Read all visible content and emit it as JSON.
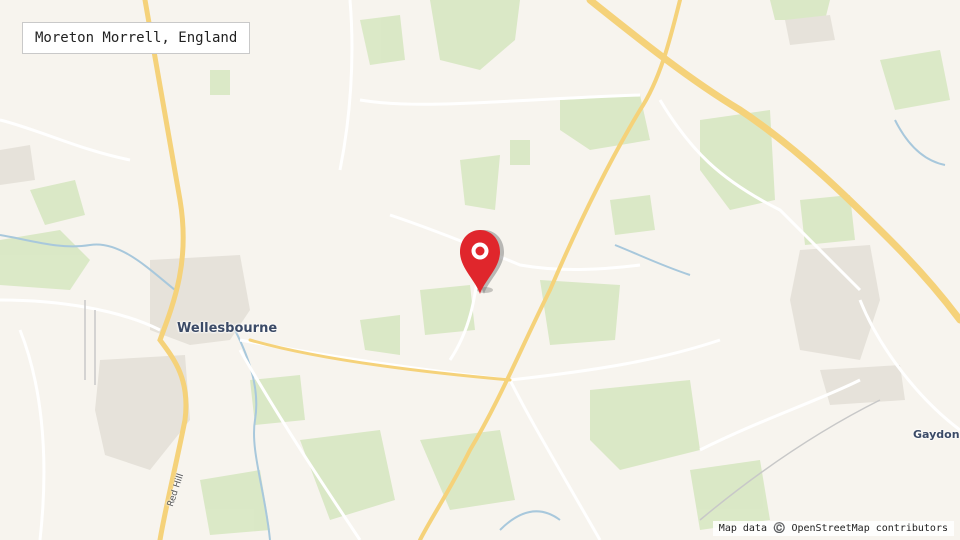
{
  "location_title": "Moreton Morrell, England",
  "places": {
    "wellesbourne": "Wellesbourne",
    "gaydon": "Gaydon"
  },
  "roads": {
    "red_hill": "Red Hill"
  },
  "attribution": "Map data ©️ OpenStreetMap contributors",
  "colors": {
    "land": "#f7f4ee",
    "woodland": "#d9e8c4",
    "water": "#a8c8dc",
    "major_road": "#f5d27a",
    "minor_road": "#ffffff",
    "urban": "#e6e2da",
    "marker": "#e0262c"
  },
  "marker_icon": "map-pin-icon"
}
